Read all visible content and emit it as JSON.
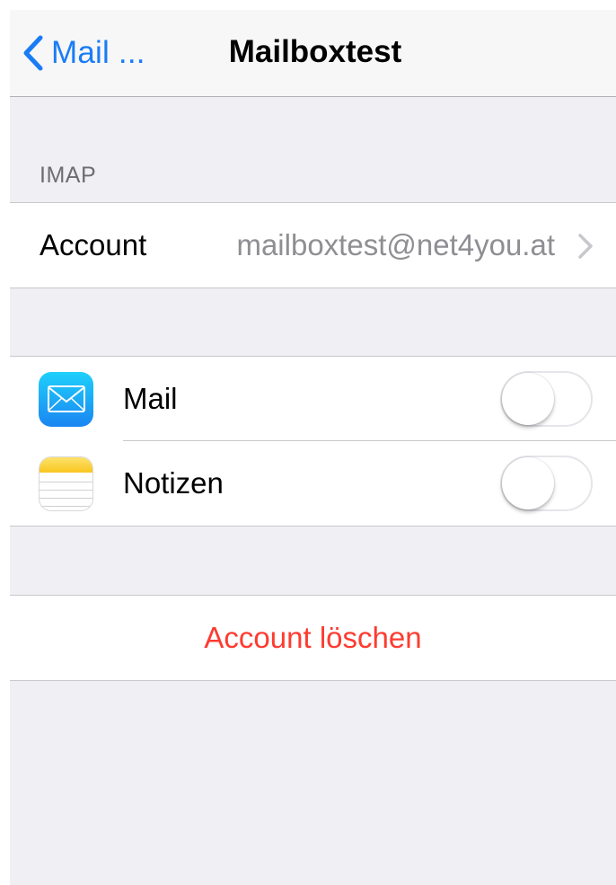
{
  "navbar": {
    "back_label": "Mail ...",
    "title": "Mailboxtest"
  },
  "section_header": "IMAP",
  "account": {
    "label": "Account",
    "value": "mailboxtest@net4you.at"
  },
  "apps": [
    {
      "label": "Mail",
      "icon": "mail-app-icon",
      "enabled": false
    },
    {
      "label": "Notizen",
      "icon": "notes-app-icon",
      "enabled": false
    }
  ],
  "delete_label": "Account löschen",
  "colors": {
    "accent": "#1a7cf5",
    "destructive": "#fe3b30",
    "background": "#efeff4",
    "secondary_text": "#8e8e93"
  }
}
